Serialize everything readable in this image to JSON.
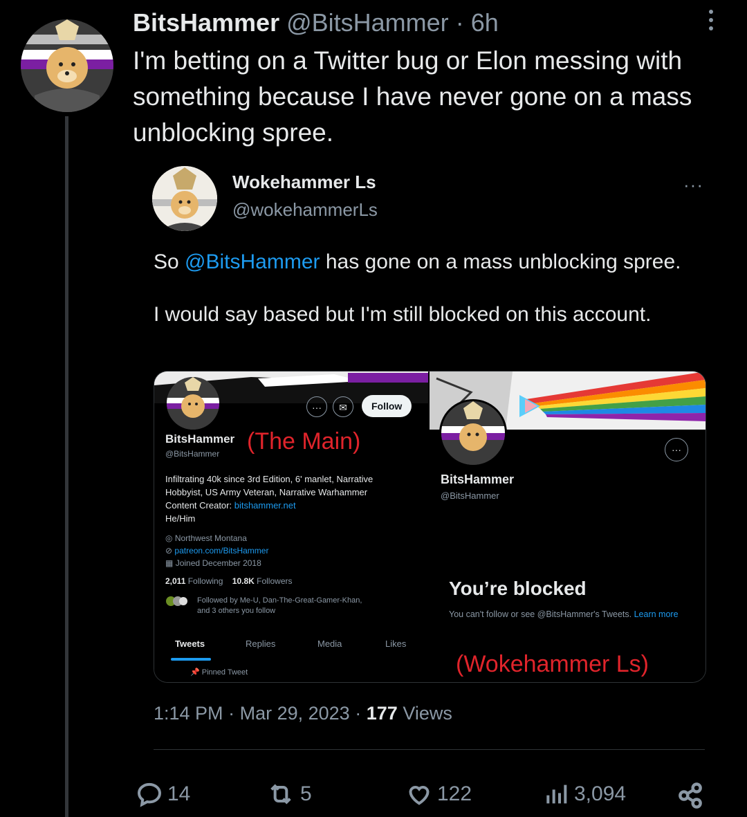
{
  "tweet": {
    "display_name": "BitsHammer",
    "handle": "@BitsHammer",
    "separator": "·",
    "age": "6h",
    "text": "I'm betting on a Twitter bug or Elon messing with something because I have never gone on a mass unblocking spree."
  },
  "quoted": {
    "display_name": "Wokehammer Ls",
    "handle": "@wokehammerLs",
    "more": "···",
    "text_prefix": "So ",
    "mention": "@BitsHammer",
    "text_suffix": " has gone on a mass unblocking spree.",
    "text_line2": "I would say based but I'm still blocked on this account.",
    "screenshot": {
      "left": {
        "name": "BitsHammer",
        "handle": "@BitsHammer",
        "follow_label": "Follow",
        "more_label": "···",
        "annotation": "(The Main)",
        "bio_line1": "Infiltrating 40k since 3rd Edition, 6' manlet, Narrative",
        "bio_line2": "Hobbyist, US Army Veteran, Narrative Warhammer",
        "bio_line3_prefix": "Content Creator: ",
        "bio_link": "bitshammer.net",
        "pronouns": "He/Him",
        "location": "Northwest Montana",
        "website": "patreon.com/BitsHammer",
        "joined": "Joined December 2018",
        "following_count": "2,011",
        "following_label": "Following",
        "followers_count": "10.8K",
        "followers_label": "Followers",
        "followed_by_line1": "Followed by Me-U, Dan-The-Great-Gamer-Khan,",
        "followed_by_line2": "and 3 others you follow",
        "tabs": [
          "Tweets",
          "Replies",
          "Media",
          "Likes"
        ],
        "pinned": "Pinned Tweet"
      },
      "right": {
        "name": "BitsHammer",
        "handle": "@BitsHammer",
        "more_label": "···",
        "blocked_title": "You’re blocked",
        "blocked_text": "You can't follow or see @BitsHammer's Tweets.",
        "learn_more": "Learn more",
        "annotation": "(Wokehammer Ls)"
      }
    }
  },
  "meta": {
    "time": "1:14 PM",
    "dot": "·",
    "date": "Mar 29, 2023",
    "views_count": "177",
    "views_label": "Views"
  },
  "actions": {
    "replies": "14",
    "retweets": "5",
    "likes": "122",
    "views": "3,094"
  },
  "colors": {
    "background": "#000000",
    "text": "#e7e9ea",
    "muted": "#8b98a5",
    "accent": "#1d9bf0",
    "annotation_red": "#e0242b"
  },
  "icons": [
    "more-vertical-icon",
    "reply-icon",
    "retweet-icon",
    "like-icon",
    "views-icon",
    "share-icon"
  ]
}
